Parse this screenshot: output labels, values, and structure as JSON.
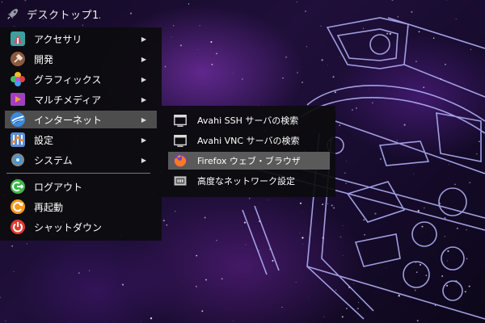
{
  "desktop": {
    "title": "デスクトップ1"
  },
  "menu": {
    "items": [
      {
        "label": "アクセサリ",
        "icon": "accessories-icon",
        "submenu": true
      },
      {
        "label": "開発",
        "icon": "development-icon",
        "submenu": true
      },
      {
        "label": "グラフィックス",
        "icon": "graphics-icon",
        "submenu": true
      },
      {
        "label": "マルチメディア",
        "icon": "multimedia-icon",
        "submenu": true
      },
      {
        "label": "インターネット",
        "icon": "internet-icon",
        "submenu": true,
        "selected": true
      },
      {
        "label": "設定",
        "icon": "settings-icon",
        "submenu": true
      },
      {
        "label": "システム",
        "icon": "system-icon",
        "submenu": true
      },
      {
        "label": "ログアウト",
        "icon": "logout-icon",
        "submenu": false
      },
      {
        "label": "再起動",
        "icon": "restart-icon",
        "submenu": false
      },
      {
        "label": "シャットダウン",
        "icon": "shutdown-icon",
        "submenu": false
      }
    ],
    "arrow": "▶"
  },
  "internet_submenu": {
    "items": [
      {
        "label": "Avahi SSH サーバの検索",
        "icon": "network-terminal-icon"
      },
      {
        "label": "Avahi VNC サーバの検索",
        "icon": "network-terminal-icon"
      },
      {
        "label": "Firefox ウェブ・ブラウザ",
        "icon": "firefox-icon",
        "selected": true
      },
      {
        "label": "高度なネットワーク設定",
        "icon": "network-settings-icon"
      }
    ]
  },
  "colors": {
    "menu_bg": "#0c0c0e",
    "selected_bg": "#4d4d4d",
    "station_line": "#b8b8ff"
  }
}
